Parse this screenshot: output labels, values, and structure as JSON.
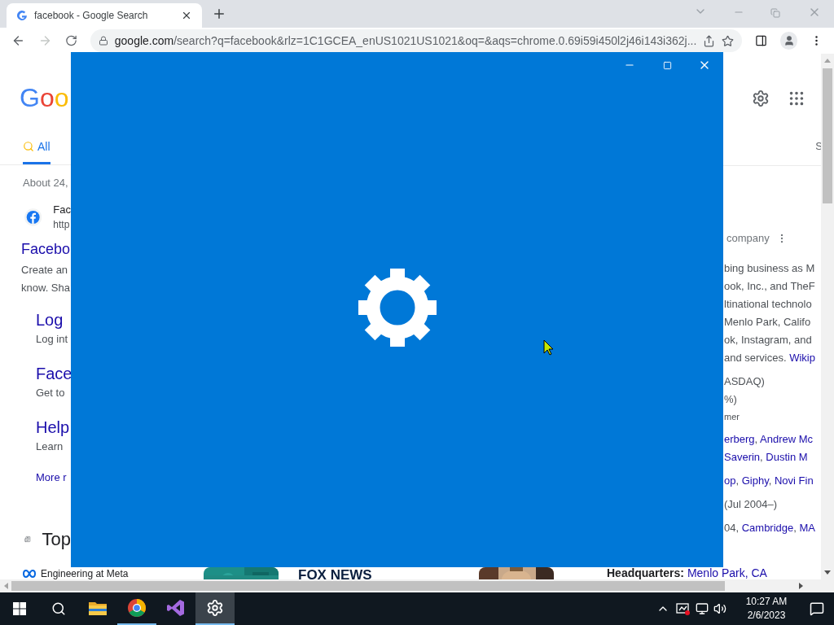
{
  "browser": {
    "tab": {
      "title": "facebook - Google Search",
      "selected": true
    },
    "url_host": "google.com",
    "url_path": "/search?q=facebook&rlz=1C1GCEA_enUS1021US1021&oq=&aqs=chrome.0.69i59i450l2j46i143i362j...",
    "forward_disabled": true
  },
  "page": {
    "logo": "Goo",
    "tabs": [
      {
        "label": "All",
        "selected": true
      }
    ],
    "tab_cut": "S",
    "result_count": "About 24,",
    "result": {
      "site": "Fac",
      "url": "http",
      "title": "Facebo",
      "snippet": [
        "Create an",
        "know. Sha"
      ]
    },
    "sitelinks": [
      {
        "title": "Log",
        "text": "Log int"
      },
      {
        "title": "Face",
        "text": "Get to"
      },
      {
        "title": "Help",
        "text": "Learn"
      }
    ],
    "more": "More r",
    "top_heading": "Top",
    "panel": {
      "subtitle": "company",
      "groups": [
        {
          "lines": [
            {
              "small": false,
              "parts": [
                {
                  "text": "bing business as M",
                  "link": false
                }
              ]
            },
            {
              "small": false,
              "parts": [
                {
                  "text": "ook, Inc., and TheF",
                  "link": false
                }
              ]
            },
            {
              "small": false,
              "parts": [
                {
                  "text": "ltinational technolo",
                  "link": false
                }
              ]
            },
            {
              "small": false,
              "parts": [
                {
                  "text": "Menlo Park, Califo",
                  "link": false
                }
              ]
            },
            {
              "small": false,
              "parts": [
                {
                  "text": "ok, Instagram, and",
                  "link": false
                }
              ]
            },
            {
              "small": false,
              "parts": [
                {
                  "text": "and services. ",
                  "link": false
                },
                {
                  "text": "Wikip",
                  "link": true
                }
              ]
            }
          ]
        },
        {
          "lines": [
            {
              "small": false,
              "parts": [
                {
                  "text": "ASDAQ)",
                  "link": false
                }
              ]
            },
            {
              "small": false,
              "parts": [
                {
                  "text": "%)",
                  "link": false
                }
              ]
            },
            {
              "small": true,
              "parts": [
                {
                  "text": "mer",
                  "link": false
                }
              ]
            }
          ]
        },
        {
          "lines": [
            {
              "small": false,
              "parts": [
                {
                  "text": "erberg",
                  "link": true
                },
                {
                  "text": ", ",
                  "link": false
                },
                {
                  "text": "Andrew Mc",
                  "link": true
                }
              ]
            },
            {
              "small": false,
              "parts": [
                {
                  "text": "Saverin",
                  "link": true
                },
                {
                  "text": ", ",
                  "link": false
                },
                {
                  "text": "Dustin M",
                  "link": true
                }
              ]
            }
          ]
        },
        {
          "lines": [
            {
              "small": false,
              "parts": [
                {
                  "text": "op",
                  "link": true
                },
                {
                  "text": ", ",
                  "link": false
                },
                {
                  "text": "Giphy",
                  "link": true
                },
                {
                  "text": ", ",
                  "link": false
                },
                {
                  "text": "Novi Fin",
                  "link": true
                }
              ]
            }
          ]
        },
        {
          "lines": [
            {
              "small": false,
              "parts": [
                {
                  "text": "(Jul 2004–)",
                  "link": false
                }
              ]
            }
          ]
        },
        {
          "lines": [
            {
              "small": false,
              "parts": [
                {
                  "text": "04, ",
                  "link": false
                },
                {
                  "text": "Cambridge",
                  "link": true
                },
                {
                  "text": ", ",
                  "link": false
                },
                {
                  "text": "MA",
                  "link": true
                }
              ]
            }
          ]
        }
      ]
    },
    "bottom": {
      "story_source": "Engineering at Meta",
      "news_source": "FOX NEWS",
      "hq_label": "Headquarters:",
      "hq_value": "Menlo Park, CA"
    }
  },
  "taskbar": {
    "apps": [
      {
        "kind": "explorer",
        "running": false,
        "selected": false
      },
      {
        "kind": "chrome",
        "running": true,
        "selected": false
      },
      {
        "kind": "studio",
        "running": false,
        "selected": false
      },
      {
        "kind": "settings",
        "running": true,
        "selected": true
      }
    ],
    "time": "10:27 AM",
    "date": "2/6/2023"
  }
}
